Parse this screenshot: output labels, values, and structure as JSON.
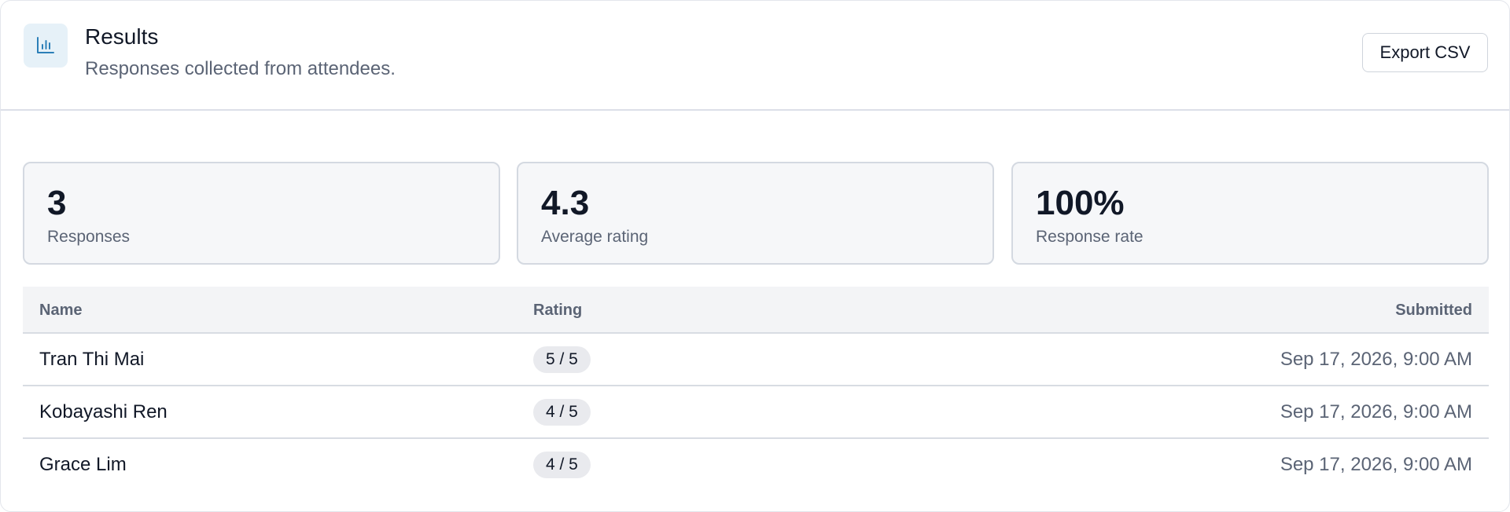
{
  "header": {
    "icon": "bar-chart-icon",
    "title": "Results",
    "subtitle": "Responses collected from attendees.",
    "export_label": "Export CSV"
  },
  "stats": [
    {
      "value": "3",
      "label": "Responses"
    },
    {
      "value": "4.3",
      "label": "Average rating"
    },
    {
      "value": "100%",
      "label": "Response rate"
    }
  ],
  "table": {
    "columns": {
      "name": "Name",
      "rating": "Rating",
      "submitted": "Submitted"
    },
    "rows": [
      {
        "name": "Tran Thi Mai",
        "rating": "5 / 5",
        "submitted": "Sep 17, 2026, 9:00 AM"
      },
      {
        "name": "Kobayashi Ren",
        "rating": "4 / 5",
        "submitted": "Sep 17, 2026, 9:00 AM"
      },
      {
        "name": "Grace Lim",
        "rating": "4 / 5",
        "submitted": "Sep 17, 2026, 9:00 AM"
      }
    ]
  },
  "colors": {
    "accent": "#2b7fb8",
    "icon_bg": "#e6f1f8",
    "muted_text": "#5b6475",
    "card_bg": "#f6f7f9",
    "pill_bg": "#e9eaee"
  }
}
